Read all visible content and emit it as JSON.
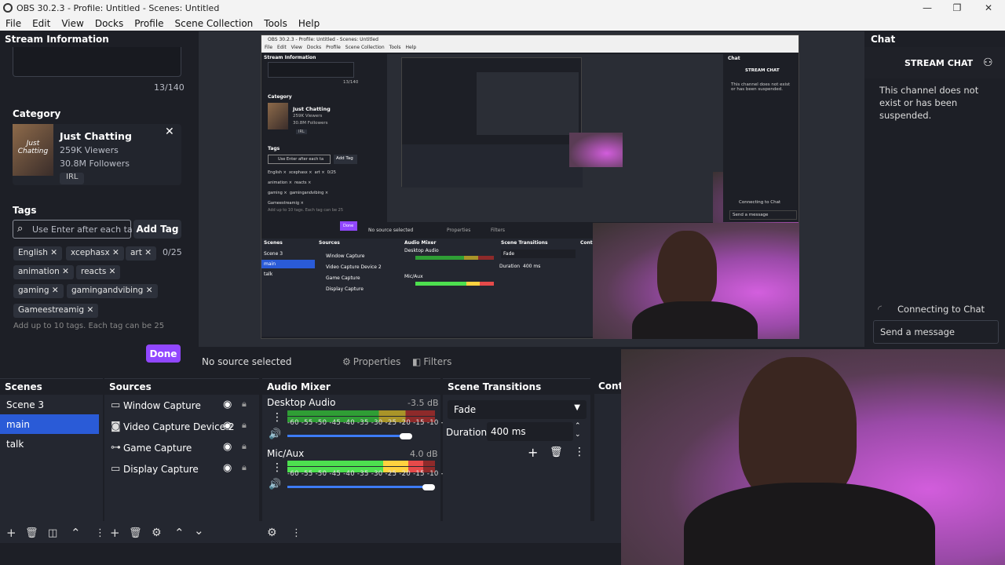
{
  "window": {
    "title": "OBS 30.2.3 - Profile: Untitled - Scenes: Untitled"
  },
  "menu": [
    "File",
    "Edit",
    "View",
    "Docks",
    "Profile",
    "Scene Collection",
    "Tools",
    "Help"
  ],
  "stream_info": {
    "header": "Stream Information",
    "char_count": "13/140",
    "category_label": "Category",
    "category": {
      "name": "Just Chatting",
      "viewers": "259K Viewers",
      "followers": "30.8M Followers",
      "tag": "IRL",
      "thumb_text": "Just Chatting"
    },
    "tags_label": "Tags",
    "tag_input_placeholder": "Use Enter after each ta",
    "add_tag": "Add Tag",
    "tags": [
      "English",
      "xcephasx",
      "art",
      "animation",
      "reacts",
      "gaming",
      "gamingandvibing",
      "Gameestreamig"
    ],
    "tag_count": "0/25",
    "hint": "Add up to 10 tags. Each tag can be 25",
    "done": "Done"
  },
  "chat": {
    "header": "Chat",
    "title": "STREAM CHAT",
    "message": "This channel does not exist or has been suspended.",
    "status": "Connecting to Chat",
    "input_placeholder": "Send a message"
  },
  "source_bar": {
    "status": "No source selected",
    "properties": "Properties",
    "filters": "Filters"
  },
  "scenes": {
    "header": "Scenes",
    "items": [
      "Scene 3",
      "main",
      "talk"
    ],
    "selected": "main"
  },
  "sources": {
    "header": "Sources",
    "items": [
      {
        "icon": "window-capture-icon",
        "glyph": "▭",
        "label": "Window Capture"
      },
      {
        "icon": "camera-icon",
        "glyph": "◙",
        "label": "Video Capture Device 2"
      },
      {
        "icon": "gamepad-icon",
        "glyph": "⊶",
        "label": "Game Capture"
      },
      {
        "icon": "monitor-icon",
        "glyph": "▭",
        "label": "Display Capture"
      }
    ]
  },
  "mixer": {
    "header": "Audio Mixer",
    "channels": [
      {
        "name": "Desktop Audio",
        "db": "-3.5 dB",
        "level": 0.0,
        "volume": 0.84
      },
      {
        "name": "Mic/Aux",
        "db": "4.0 dB",
        "level": 0.92,
        "volume": 1.0
      }
    ],
    "scale": "-60 -55 -50 -45 -40 -35 -30 -25 -20 -15 -10  -5   0"
  },
  "transitions": {
    "header": "Scene Transitions",
    "type": "Fade",
    "duration_label": "Duration",
    "duration": "400 ms"
  },
  "controls": {
    "header": "Contr"
  },
  "inner_preview": {
    "title": "OBS 30.2.3 - Profile: Untitled - Scenes: Untitled",
    "menu": [
      "File",
      "Edit",
      "View",
      "Docks",
      "Profile",
      "Scene Collection",
      "Tools",
      "Help"
    ],
    "stream_info": "Stream Information",
    "char_count": "13/140",
    "category_label": "Category",
    "category_name": "Just Chatting",
    "viewers": "259K Viewers",
    "followers": "30.8M Followers",
    "tag": "IRL",
    "tags_label": "Tags",
    "tag_input": "Use Enter after each ta",
    "add_tag": "Add Tag",
    "tags": [
      "English ×",
      "xcephasx ×",
      "art ×",
      "0/25",
      "animation ×",
      "reacts ×",
      "gaming ×",
      "gamingandvibing ×",
      "Gameestreamig ×"
    ],
    "hint": "Add up to 10 tags. Each tag can be 25",
    "done": "Done",
    "no_source": "No source selected",
    "properties": "Properties",
    "filters": "Filters",
    "chat": "Chat",
    "chat_title": "STREAM CHAT",
    "chat_msg": "This channel does not exist or has been suspended.",
    "connecting": "Connecting to Chat",
    "send": "Send a message",
    "scenes": "Scenes",
    "scene_items": [
      "Scene 3",
      "main",
      "talk"
    ],
    "sources": "Sources",
    "source_items": [
      "Window Capture",
      "Video Capture Device 2",
      "Game Capture",
      "Display Capture"
    ],
    "mixer": "Audio Mixer",
    "desktop": "Desktop Audio",
    "mic": "Mic/Aux",
    "transitions": "Scene Transitions",
    "fade": "Fade",
    "duration": "Duration",
    "duration_val": "400 ms",
    "contr": "Contr"
  }
}
